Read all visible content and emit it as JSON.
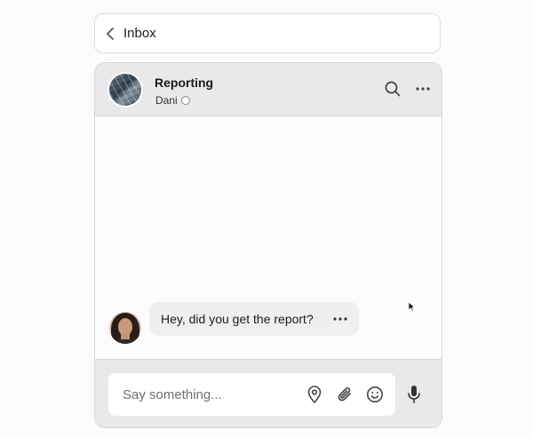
{
  "nav": {
    "back_label": "Inbox"
  },
  "chat": {
    "channel_name": "Reporting",
    "member_name": "Dani",
    "status": "offline"
  },
  "messages": [
    {
      "author": "Dani",
      "text": "Hey, did you get the report?"
    }
  ],
  "composer": {
    "placeholder": "Say something..."
  },
  "icons": {
    "back": "chevron-left-icon",
    "search": "search-icon",
    "header_more": "more-horizontal-icon",
    "message_more": "more-horizontal-icon",
    "location": "map-pin-icon",
    "attach": "paperclip-icon",
    "emoji": "smile-icon",
    "mic": "microphone-icon"
  }
}
